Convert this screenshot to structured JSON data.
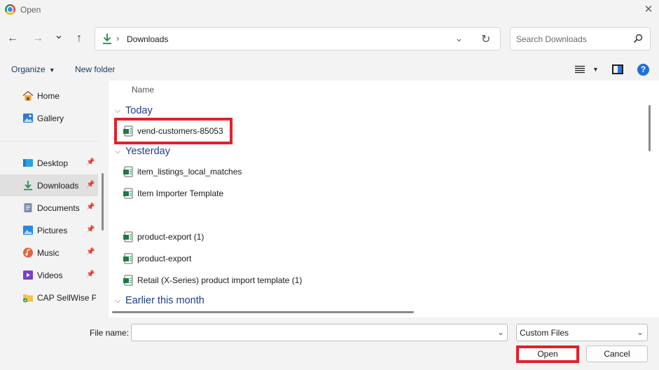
{
  "window": {
    "title": "Open",
    "close_glyph": "✕"
  },
  "nav": {
    "back_glyph": "←",
    "forward_glyph": "→",
    "recent_glyph": "⌄",
    "up_glyph": "↑",
    "address": {
      "separator": "›",
      "location": "Downloads",
      "dropdown_glyph": "⌄",
      "refresh_glyph": "↻"
    },
    "search": {
      "placeholder": "Search Downloads"
    }
  },
  "toolbar": {
    "organize_label": "Organize",
    "caret_glyph": "▼",
    "new_folder_label": "New folder",
    "help_glyph": "?"
  },
  "sidebar": {
    "pin_glyph": "📌",
    "items": [
      {
        "label": "Home",
        "icon": "home-icon",
        "pinned": false
      },
      {
        "label": "Gallery",
        "icon": "gallery-icon",
        "pinned": false
      },
      {
        "label": "Desktop",
        "icon": "desktop-icon",
        "pinned": true
      },
      {
        "label": "Downloads",
        "icon": "downloads-icon",
        "pinned": true,
        "active": true
      },
      {
        "label": "Documents",
        "icon": "documents-icon",
        "pinned": true
      },
      {
        "label": "Pictures",
        "icon": "pictures-icon",
        "pinned": true
      },
      {
        "label": "Music",
        "icon": "music-icon",
        "pinned": true
      },
      {
        "label": "Videos",
        "icon": "videos-icon",
        "pinned": true
      },
      {
        "label": "CAP SellWise Pr",
        "icon": "folder-icon",
        "pinned": false
      }
    ]
  },
  "content": {
    "column_name": "Name",
    "groups": [
      {
        "label": "Today",
        "files": [
          "vend-customers-85053"
        ]
      },
      {
        "label": "Yesterday",
        "files": [
          "item_listings_local_matches",
          "Item Importer Template",
          "",
          "product-export (1)",
          "product-export",
          "Retail (X-Series) product import template (1)"
        ]
      },
      {
        "label": "Earlier this month",
        "files": []
      }
    ],
    "group_chevron": "⌵"
  },
  "bottom": {
    "file_name_label": "File name:",
    "file_name_value": "",
    "file_type": "Custom Files",
    "dropdown_glyph": "⌄",
    "open_label": "Open",
    "cancel_label": "Cancel"
  },
  "colors": {
    "accent_red": "#e3202b",
    "link_blue": "#1e3e8a",
    "excel_green": "#1d7a45"
  }
}
